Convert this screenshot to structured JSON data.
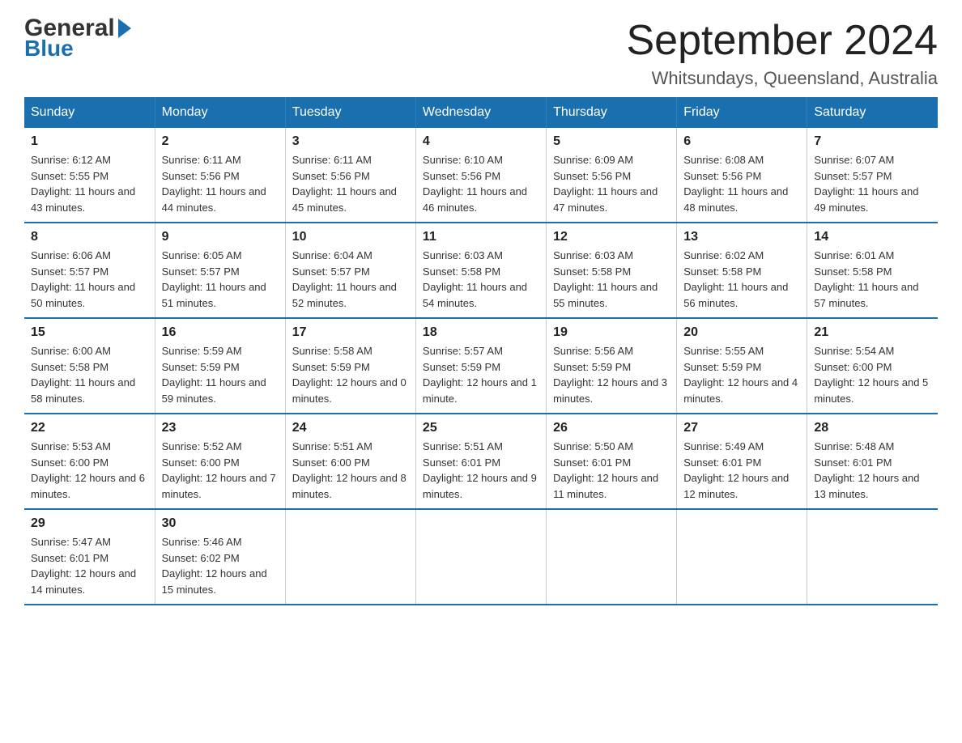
{
  "header": {
    "logo_general": "General",
    "logo_blue": "Blue",
    "title": "September 2024",
    "subtitle": "Whitsundays, Queensland, Australia"
  },
  "days_of_week": [
    "Sunday",
    "Monday",
    "Tuesday",
    "Wednesday",
    "Thursday",
    "Friday",
    "Saturday"
  ],
  "weeks": [
    [
      {
        "day": "1",
        "sunrise": "6:12 AM",
        "sunset": "5:55 PM",
        "daylight": "11 hours and 43 minutes."
      },
      {
        "day": "2",
        "sunrise": "6:11 AM",
        "sunset": "5:56 PM",
        "daylight": "11 hours and 44 minutes."
      },
      {
        "day": "3",
        "sunrise": "6:11 AM",
        "sunset": "5:56 PM",
        "daylight": "11 hours and 45 minutes."
      },
      {
        "day": "4",
        "sunrise": "6:10 AM",
        "sunset": "5:56 PM",
        "daylight": "11 hours and 46 minutes."
      },
      {
        "day": "5",
        "sunrise": "6:09 AM",
        "sunset": "5:56 PM",
        "daylight": "11 hours and 47 minutes."
      },
      {
        "day": "6",
        "sunrise": "6:08 AM",
        "sunset": "5:56 PM",
        "daylight": "11 hours and 48 minutes."
      },
      {
        "day": "7",
        "sunrise": "6:07 AM",
        "sunset": "5:57 PM",
        "daylight": "11 hours and 49 minutes."
      }
    ],
    [
      {
        "day": "8",
        "sunrise": "6:06 AM",
        "sunset": "5:57 PM",
        "daylight": "11 hours and 50 minutes."
      },
      {
        "day": "9",
        "sunrise": "6:05 AM",
        "sunset": "5:57 PM",
        "daylight": "11 hours and 51 minutes."
      },
      {
        "day": "10",
        "sunrise": "6:04 AM",
        "sunset": "5:57 PM",
        "daylight": "11 hours and 52 minutes."
      },
      {
        "day": "11",
        "sunrise": "6:03 AM",
        "sunset": "5:58 PM",
        "daylight": "11 hours and 54 minutes."
      },
      {
        "day": "12",
        "sunrise": "6:03 AM",
        "sunset": "5:58 PM",
        "daylight": "11 hours and 55 minutes."
      },
      {
        "day": "13",
        "sunrise": "6:02 AM",
        "sunset": "5:58 PM",
        "daylight": "11 hours and 56 minutes."
      },
      {
        "day": "14",
        "sunrise": "6:01 AM",
        "sunset": "5:58 PM",
        "daylight": "11 hours and 57 minutes."
      }
    ],
    [
      {
        "day": "15",
        "sunrise": "6:00 AM",
        "sunset": "5:58 PM",
        "daylight": "11 hours and 58 minutes."
      },
      {
        "day": "16",
        "sunrise": "5:59 AM",
        "sunset": "5:59 PM",
        "daylight": "11 hours and 59 minutes."
      },
      {
        "day": "17",
        "sunrise": "5:58 AM",
        "sunset": "5:59 PM",
        "daylight": "12 hours and 0 minutes."
      },
      {
        "day": "18",
        "sunrise": "5:57 AM",
        "sunset": "5:59 PM",
        "daylight": "12 hours and 1 minute."
      },
      {
        "day": "19",
        "sunrise": "5:56 AM",
        "sunset": "5:59 PM",
        "daylight": "12 hours and 3 minutes."
      },
      {
        "day": "20",
        "sunrise": "5:55 AM",
        "sunset": "5:59 PM",
        "daylight": "12 hours and 4 minutes."
      },
      {
        "day": "21",
        "sunrise": "5:54 AM",
        "sunset": "6:00 PM",
        "daylight": "12 hours and 5 minutes."
      }
    ],
    [
      {
        "day": "22",
        "sunrise": "5:53 AM",
        "sunset": "6:00 PM",
        "daylight": "12 hours and 6 minutes."
      },
      {
        "day": "23",
        "sunrise": "5:52 AM",
        "sunset": "6:00 PM",
        "daylight": "12 hours and 7 minutes."
      },
      {
        "day": "24",
        "sunrise": "5:51 AM",
        "sunset": "6:00 PM",
        "daylight": "12 hours and 8 minutes."
      },
      {
        "day": "25",
        "sunrise": "5:51 AM",
        "sunset": "6:01 PM",
        "daylight": "12 hours and 9 minutes."
      },
      {
        "day": "26",
        "sunrise": "5:50 AM",
        "sunset": "6:01 PM",
        "daylight": "12 hours and 11 minutes."
      },
      {
        "day": "27",
        "sunrise": "5:49 AM",
        "sunset": "6:01 PM",
        "daylight": "12 hours and 12 minutes."
      },
      {
        "day": "28",
        "sunrise": "5:48 AM",
        "sunset": "6:01 PM",
        "daylight": "12 hours and 13 minutes."
      }
    ],
    [
      {
        "day": "29",
        "sunrise": "5:47 AM",
        "sunset": "6:01 PM",
        "daylight": "12 hours and 14 minutes."
      },
      {
        "day": "30",
        "sunrise": "5:46 AM",
        "sunset": "6:02 PM",
        "daylight": "12 hours and 15 minutes."
      },
      null,
      null,
      null,
      null,
      null
    ]
  ],
  "labels": {
    "sunrise": "Sunrise:",
    "sunset": "Sunset:",
    "daylight": "Daylight:"
  }
}
